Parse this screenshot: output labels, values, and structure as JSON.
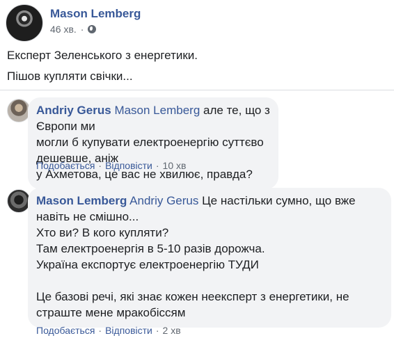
{
  "post": {
    "author": "Mason Lemberg",
    "time": "46 хв.",
    "dot": "·",
    "lines": [
      "Експерт Зеленського з енергетики.",
      "Пішов купляти свічки..."
    ]
  },
  "comments": [
    {
      "author": "Andriy Gerus",
      "mention": "Mason Lemberg",
      "text_lines": [
        "але те, що з Європи ми",
        "могли б купувати електроенергію суттєво дешевше, аніж",
        "у Ахметова, це вас не хвилює, правда?"
      ],
      "like": "Подобається",
      "reply": "Відповісти",
      "time": "10 хв",
      "sep": "·"
    },
    {
      "author": "Mason Lemberg",
      "mention": "Andriy Gerus",
      "text_lines": [
        "Це настільки сумно, що вже",
        "навіть не смішно...",
        "Хто ви? В кого купляти?",
        "Там електроенергія в 5-10 разів дорожча.",
        "Україна експортує електроенергію ТУДИ"
      ],
      "text_lines_2": [
        "Це базові речі, які знає кожен неексперт з енергетики, не",
        "страште мене мракобіссям"
      ],
      "like": "Подобається",
      "reply": "Відповісти",
      "time": "2 хв",
      "sep": "·"
    }
  ],
  "icons": {
    "privacy": "globe-icon"
  }
}
